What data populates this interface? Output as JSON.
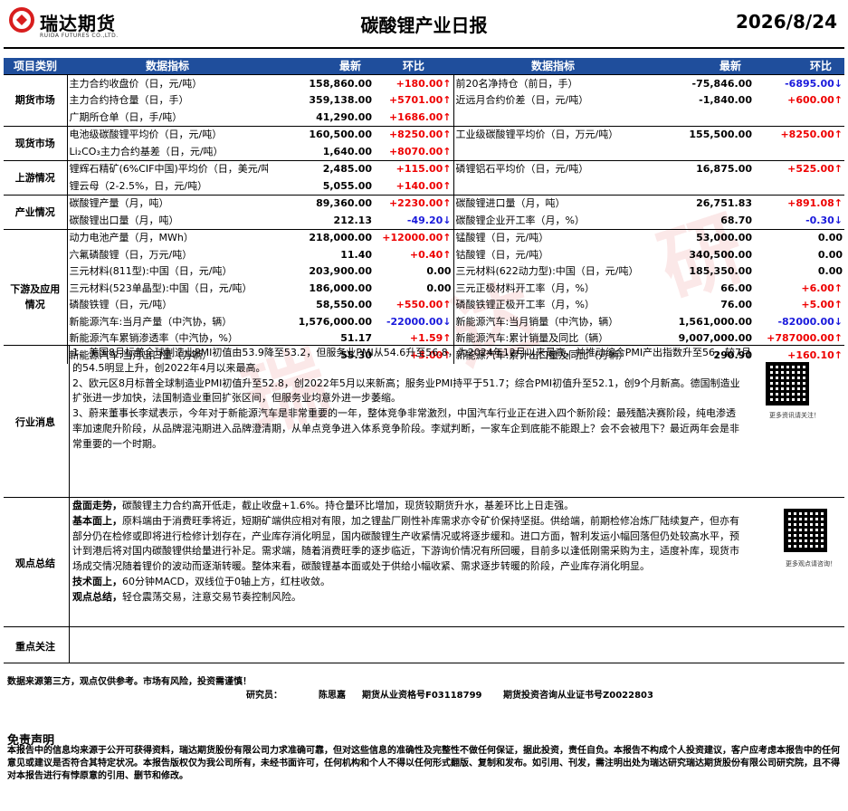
{
  "header": {
    "company_name": "瑞达期货",
    "company_sub": "RUIDA FUTURES CO.,LTD.",
    "title": "碳酸锂产业日报",
    "date": "2026/8/24"
  },
  "columns": {
    "category": "项目类别",
    "indicator_left": "数据指标",
    "latest_left": "最新",
    "change_left": "环比",
    "indicator_right": "数据指标",
    "latest_right": "最新",
    "change_right": "环比"
  },
  "sections": [
    {
      "category": "期货市场",
      "rows": [
        {
          "li": "主力合约收盘价（日，元/吨）",
          "lv": "158,860.00",
          "lc": "+180.00↑",
          "ld": "up",
          "ri": "前20名净持仓（前日，手）",
          "rv": "-75,846.00",
          "rc": "-6895.00↓",
          "rd": "down"
        },
        {
          "li": "主力合约持仓量（日，手）",
          "lv": "359,138.00",
          "lc": "+5701.00↑",
          "ld": "up",
          "ri": "近远月合约价差（日，元/吨）",
          "rv": "-1,840.00",
          "rc": "+600.00↑",
          "rd": "up"
        },
        {
          "li": "广期所仓单（日，手/吨）",
          "lv": "41,290.00",
          "lc": "+1686.00↑",
          "ld": "up",
          "ri": "",
          "rv": "",
          "rc": "",
          "rd": ""
        }
      ]
    },
    {
      "category": "现货市场",
      "rows": [
        {
          "li": "电池级碳酸锂平均价（日，元/吨）",
          "lv": "160,500.00",
          "lc": "+8250.00↑",
          "ld": "up",
          "ri": "工业级碳酸锂平均价（日，万元/吨）",
          "rv": "155,500.00",
          "rc": "+8250.00↑",
          "rd": "up"
        },
        {
          "li": "Li₂CO₃主力合约基差（日，元/吨）",
          "lv": "1,640.00",
          "lc": "+8070.00↑",
          "ld": "up",
          "ri": "",
          "rv": "",
          "rc": "",
          "rd": ""
        }
      ]
    },
    {
      "category": "上游情况",
      "rows": [
        {
          "li": "锂辉石精矿(6%CIF中国)平均价（日，美元/吨）",
          "lv": "2,485.00",
          "lc": "+115.00↑",
          "ld": "up",
          "ri": "磷锂铝石平均价（日，元/吨）",
          "rv": "16,875.00",
          "rc": "+525.00↑",
          "rd": "up"
        },
        {
          "li": "锂云母（2-2.5%，日，元/吨）",
          "lv": "5,055.00",
          "lc": "+140.00↑",
          "ld": "up",
          "ri": "",
          "rv": "",
          "rc": "",
          "rd": ""
        }
      ]
    },
    {
      "category": "产业情况",
      "rows": [
        {
          "li": "碳酸锂产量（月，吨）",
          "lv": "89,360.00",
          "lc": "+2230.00↑",
          "ld": "up",
          "ri": "碳酸锂进口量（月，吨）",
          "rv": "26,751.83",
          "rc": "+891.08↑",
          "rd": "up"
        },
        {
          "li": "碳酸锂出口量（月，吨）",
          "lv": "212.13",
          "lc": "-49.20↓",
          "ld": "down",
          "ri": "碳酸锂企业开工率（月，%）",
          "rv": "68.70",
          "rc": "-0.30↓",
          "rd": "down"
        }
      ]
    },
    {
      "category": "下游及应用情况",
      "rows": [
        {
          "li": "动力电池产量（月，MWh）",
          "lv": "218,000.00",
          "lc": "+12000.00↑",
          "ld": "up",
          "ri": "锰酸锂（日，元/吨）",
          "rv": "53,000.00",
          "rc": "0.00",
          "rd": "zero"
        },
        {
          "li": "六氟磷酸锂（日，万元/吨）",
          "lv": "11.40",
          "lc": "+0.40↑",
          "ld": "up",
          "ri": "钴酸锂（日，元/吨）",
          "rv": "340,500.00",
          "rc": "0.00",
          "rd": "zero"
        },
        {
          "li": "三元材料(811型):中国（日，元/吨）",
          "lv": "203,900.00",
          "lc": "0.00",
          "ld": "zero",
          "ri": "三元材料(622动力型):中国（日，元/吨）",
          "rv": "185,350.00",
          "rc": "0.00",
          "rd": "zero"
        },
        {
          "li": "三元材料(523单晶型):中国（日，元/吨）",
          "lv": "186,000.00",
          "lc": "0.00",
          "ld": "zero",
          "ri": "三元正极材料开工率（月，%）",
          "rv": "66.00",
          "rc": "+6.00↑",
          "rd": "up"
        },
        {
          "li": "磷酸铁锂（日，元/吨）",
          "lv": "58,550.00",
          "lc": "+550.00↑",
          "ld": "up",
          "ri": "磷酸铁锂正极开工率（月，%）",
          "rv": "76.00",
          "rc": "+5.00↑",
          "rd": "up"
        },
        {
          "li": "新能源汽车:当月产量（中汽协，辆）",
          "lv": "1,576,000.00",
          "lc": "-22000.00↓",
          "ld": "down",
          "ri": "新能源汽车:当月销量（中汽协，辆）",
          "rv": "1,561,000.00",
          "rc": "-82000.00↓",
          "rd": "down"
        },
        {
          "li": "新能源汽车累销渗透率（中汽协，%）",
          "lv": "51.17",
          "lc": "+1.59↑",
          "ld": "up",
          "ri": "新能源汽车:累计销量及同比（辆）",
          "rv": "9,007,000.00",
          "rc": "+787000.00↑",
          "rd": "up"
        },
        {
          "li": "新能源汽车:当月出口量（万辆）",
          "lv": "55.30",
          "lc": "+3.00↑",
          "ld": "up",
          "ri": "新能源汽车:累计出口量及同比（万辆）",
          "rv": "290.90",
          "rc": "+160.10↑",
          "rd": "up"
        }
      ]
    }
  ],
  "news": {
    "label": "行业消息",
    "lines": [
      "1、美国8月标普全球制造业PMI初值由53.9降至53.2，但服务业PMI从54.6升至56.8，为2024年12月以来最高，并推动综合PMI产出指数升至56，较7月",
      "的54.5明显上升，创2022年4月以来最高。",
      "2、欧元区8月标普全球制造业PMI初值升至52.8，创2022年5月以来新高；服务业PMI持平于51.7；综合PMI初值升至52.1，创9个月新高。德国制造业",
      "扩张进一步加快，法国制造业重回扩张区间，但服务业均意外进一步萎缩。",
      "3、蔚来董事长李斌表示，今年对于新能源汽车是非常重要的一年，整体竞争非常激烈，中国汽车行业正在进入四个新阶段：最残酷决赛阶段，纯电渗透",
      "率加速爬升阶段，从品牌混沌期进入品牌澄清期，从单点竞争进入体系竞争阶段。李斌判断，一家车企到底能不能跟上？会不会被甩下？最近两年会是非",
      "常重要的一个时期。"
    ],
    "qr_caption": "更多资讯请关注！"
  },
  "views": {
    "label": "观点总结",
    "p1_head": "盘面走势，",
    "p1": "碳酸锂主力合约高开低走，截止收盘+1.6%。持仓量环比增加，现货较期货升水，基差环比上日走强。",
    "p2_head": "基本面上，",
    "p2_lines": [
      "原料端由于消费旺季将近，短期矿端供应相对有限，加之锂盐厂刚性补库需求亦令矿价保持坚挺。供给端，前期检修冶炼厂陆续复产，但亦有",
      "部分仍在检修或即将进行检修计划存在，产业库存消化明显，国内碳酸锂生产收紧情况或将逐步缓和。进口方面，智利发运小幅回落但仍处较高水平，预",
      "计到港后将对国内碳酸锂供给量进行补足。需求端，随着消费旺季的逐步临近，下游询价情况有所回暖，目前多以逢低刚需采购为主，适度补库，现货市",
      "场成交情况随着锂价的波动而逐渐转暖。整体来看，碳酸锂基本面或处于供给小幅收紧、需求逐步转暖的阶段，产业库存消化明显。"
    ],
    "p3_head": "技术面上，",
    "p3": "60分钟MACD，双线位于0轴上方，红柱收敛。",
    "p4_head": "观点总结，",
    "p4": "轻仓震荡交易，注意交易节奏控制风险。",
    "qr_caption": "更多观点请咨询！"
  },
  "focus": {
    "label": "重点关注"
  },
  "footer": {
    "source": "数据来源第三方，观点仅供参考。市场有风险，投资需谨慎！",
    "researcher_label": "研究员：",
    "researcher_name": "陈思嘉",
    "qualification": "期货从业资格号F03118799",
    "consult": "期货投资咨询从业证书号Z0022803",
    "disclaimer_title": "免责声明",
    "disclaimer": "本报告中的信息均来源于公开可获得资料，瑞达期货股份有限公司力求准确可靠，但对这些信息的准确性及完整性不做任何保证，据此投资，责任自负。本报告不构成个人投资建议，客户应考虑本报告中的任何意见或建议是否符合其特定状况。本报告版权仅为我公司所有，未经书面许可，任何机构和个人不得以任何形式翻版、复制和发布。如引用、刊发，需注明出处为瑞达研究瑞达期货股份有限公司研究院，且不得对本报告进行有悖原意的引用、删节和修改。"
  },
  "watermark": "瑞 达 研 究",
  "colors": {
    "header_bg": "#1f4e9c",
    "up": "#ee0000",
    "down": "#1a1adc"
  }
}
